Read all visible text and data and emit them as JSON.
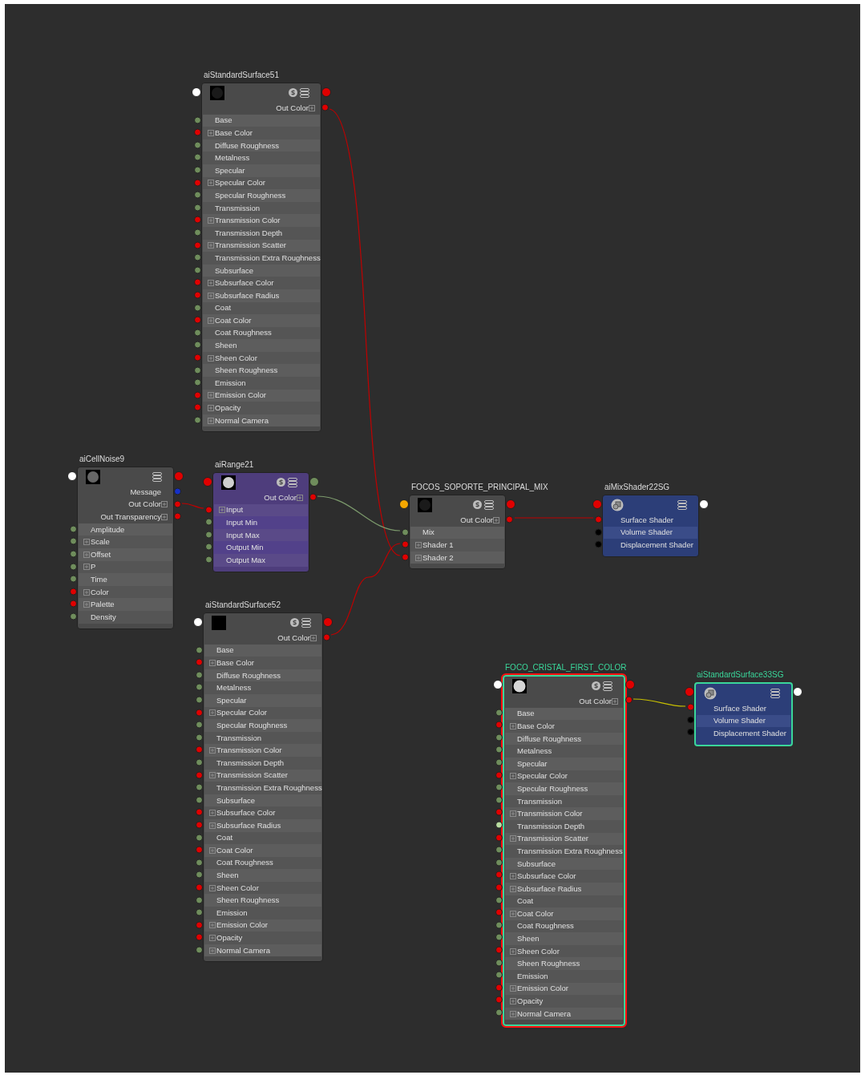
{
  "nodes": [
    {
      "title": "aiStandardSurface51",
      "kind": "shader",
      "selected": false,
      "focused": false,
      "swatch": {
        "kind": "dark_sphere"
      },
      "s_icon": true,
      "in_port": {
        "color": "#ffffff"
      },
      "out_port": {
        "color": "#e00000"
      },
      "outputs": [
        {
          "label": "Out Color",
          "color": "#e00000",
          "expandable": true
        }
      ],
      "attributes": [
        {
          "label": "Base",
          "color": "#6f8d5c",
          "expandable": false
        },
        {
          "label": "Base Color",
          "color": "#e00000",
          "expandable": true
        },
        {
          "label": "Diffuse Roughness",
          "color": "#6f8d5c",
          "expandable": false
        },
        {
          "label": "Metalness",
          "color": "#6f8d5c",
          "expandable": false
        },
        {
          "label": "Specular",
          "color": "#6f8d5c",
          "expandable": false
        },
        {
          "label": "Specular Color",
          "color": "#e00000",
          "expandable": true
        },
        {
          "label": "Specular Roughness",
          "color": "#6f8d5c",
          "expandable": false
        },
        {
          "label": "Transmission",
          "color": "#6f8d5c",
          "expandable": false
        },
        {
          "label": "Transmission Color",
          "color": "#e00000",
          "expandable": true
        },
        {
          "label": "Transmission Depth",
          "color": "#6f8d5c",
          "expandable": false
        },
        {
          "label": "Transmission Scatter",
          "color": "#e00000",
          "expandable": true
        },
        {
          "label": "Transmission Extra Roughness",
          "color": "#6f8d5c",
          "expandable": false
        },
        {
          "label": "Subsurface",
          "color": "#6f8d5c",
          "expandable": false
        },
        {
          "label": "Subsurface Color",
          "color": "#e00000",
          "expandable": true
        },
        {
          "label": "Subsurface Radius",
          "color": "#e00000",
          "expandable": true
        },
        {
          "label": "Coat",
          "color": "#6f8d5c",
          "expandable": false
        },
        {
          "label": "Coat Color",
          "color": "#e00000",
          "expandable": true
        },
        {
          "label": "Coat Roughness",
          "color": "#6f8d5c",
          "expandable": false
        },
        {
          "label": "Sheen",
          "color": "#6f8d5c",
          "expandable": false
        },
        {
          "label": "Sheen Color",
          "color": "#e00000",
          "expandable": true
        },
        {
          "label": "Sheen Roughness",
          "color": "#6f8d5c",
          "expandable": false
        },
        {
          "label": "Emission",
          "color": "#6f8d5c",
          "expandable": false
        },
        {
          "label": "Emission Color",
          "color": "#e00000",
          "expandable": true
        },
        {
          "label": "Opacity",
          "color": "#e00000",
          "expandable": true
        },
        {
          "label": "Normal Camera",
          "color": "#6f8d5c",
          "expandable": true
        }
      ]
    },
    {
      "title": "aiCellNoise9",
      "kind": "texture",
      "selected": false,
      "focused": false,
      "swatch": {
        "kind": "gray_noise"
      },
      "s_icon": false,
      "in_port": {
        "color": "#ffffff"
      },
      "out_port": {
        "color": "#e00000"
      },
      "outputs": [
        {
          "label": "Message",
          "color": "#1530c8",
          "expandable": false
        },
        {
          "label": "Out Color",
          "color": "#e00000",
          "expandable": true
        },
        {
          "label": "Out Transparency",
          "color": "#e00000",
          "expandable": true
        }
      ],
      "attributes": [
        {
          "label": "Amplitude",
          "color": "#6f8d5c",
          "expandable": false
        },
        {
          "label": "Scale",
          "color": "#6f8d5c",
          "expandable": true
        },
        {
          "label": "Offset",
          "color": "#6f8d5c",
          "expandable": true
        },
        {
          "label": "P",
          "color": "#6f8d5c",
          "expandable": true
        },
        {
          "label": "Time",
          "color": "#6f8d5c",
          "expandable": false
        },
        {
          "label": "Color",
          "color": "#e00000",
          "expandable": true
        },
        {
          "label": "Palette",
          "color": "#e00000",
          "expandable": true
        },
        {
          "label": "Density",
          "color": "#6f8d5c",
          "expandable": false
        }
      ]
    },
    {
      "title": "aiRange21",
      "kind": "utility",
      "selected": false,
      "focused": false,
      "swatch": {
        "kind": "white_noise"
      },
      "s_icon": true,
      "in_port": {
        "color": "#e00000"
      },
      "out_port": {
        "color": "#6f8d5c"
      },
      "outputs": [
        {
          "label": "Out Color",
          "color": "#e00000",
          "expandable": true
        }
      ],
      "attributes": [
        {
          "label": "Input",
          "color": "#e00000",
          "expandable": true
        },
        {
          "label": "Input Min",
          "color": "#6f8d5c",
          "expandable": false
        },
        {
          "label": "Input Max",
          "color": "#6f8d5c",
          "expandable": false
        },
        {
          "label": "Output Min",
          "color": "#6f8d5c",
          "expandable": false
        },
        {
          "label": "Output Max",
          "color": "#6f8d5c",
          "expandable": false
        }
      ]
    },
    {
      "title": "aiStandardSurface52",
      "kind": "shader",
      "selected": false,
      "focused": false,
      "swatch": {
        "kind": "black"
      },
      "s_icon": true,
      "in_port": {
        "color": "#ffffff"
      },
      "out_port": {
        "color": "#e00000"
      },
      "outputs": [
        {
          "label": "Out Color",
          "color": "#e00000",
          "expandable": true
        }
      ],
      "attributes": [
        {
          "label": "Base",
          "color": "#6f8d5c",
          "expandable": false
        },
        {
          "label": "Base Color",
          "color": "#e00000",
          "expandable": true
        },
        {
          "label": "Diffuse Roughness",
          "color": "#6f8d5c",
          "expandable": false
        },
        {
          "label": "Metalness",
          "color": "#6f8d5c",
          "expandable": false
        },
        {
          "label": "Specular",
          "color": "#6f8d5c",
          "expandable": false
        },
        {
          "label": "Specular Color",
          "color": "#e00000",
          "expandable": true
        },
        {
          "label": "Specular Roughness",
          "color": "#6f8d5c",
          "expandable": false
        },
        {
          "label": "Transmission",
          "color": "#6f8d5c",
          "expandable": false
        },
        {
          "label": "Transmission Color",
          "color": "#e00000",
          "expandable": true
        },
        {
          "label": "Transmission Depth",
          "color": "#6f8d5c",
          "expandable": false
        },
        {
          "label": "Transmission Scatter",
          "color": "#e00000",
          "expandable": true
        },
        {
          "label": "Transmission Extra Roughness",
          "color": "#6f8d5c",
          "expandable": false
        },
        {
          "label": "Subsurface",
          "color": "#6f8d5c",
          "expandable": false
        },
        {
          "label": "Subsurface Color",
          "color": "#e00000",
          "expandable": true
        },
        {
          "label": "Subsurface Radius",
          "color": "#e00000",
          "expandable": true
        },
        {
          "label": "Coat",
          "color": "#6f8d5c",
          "expandable": false
        },
        {
          "label": "Coat Color",
          "color": "#e00000",
          "expandable": true
        },
        {
          "label": "Coat Roughness",
          "color": "#6f8d5c",
          "expandable": false
        },
        {
          "label": "Sheen",
          "color": "#6f8d5c",
          "expandable": false
        },
        {
          "label": "Sheen Color",
          "color": "#e00000",
          "expandable": true
        },
        {
          "label": "Sheen Roughness",
          "color": "#6f8d5c",
          "expandable": false
        },
        {
          "label": "Emission",
          "color": "#6f8d5c",
          "expandable": false
        },
        {
          "label": "Emission Color",
          "color": "#e00000",
          "expandable": true
        },
        {
          "label": "Opacity",
          "color": "#e00000",
          "expandable": true
        },
        {
          "label": "Normal Camera",
          "color": "#6f8d5c",
          "expandable": true
        }
      ]
    },
    {
      "title": "FOCOS_SOPORTE_PRINCIPAL_MIX",
      "kind": "shader",
      "selected": false,
      "focused": false,
      "swatch": {
        "kind": "dark_sphere"
      },
      "s_icon": true,
      "in_port": {
        "color": "#f5a700"
      },
      "out_port": {
        "color": "#e00000"
      },
      "outputs": [
        {
          "label": "Out Color",
          "color": "#e00000",
          "expandable": true
        }
      ],
      "attributes": [
        {
          "label": "Mix",
          "color": "#6f8d5c",
          "expandable": false
        },
        {
          "label": "Shader 1",
          "color": "#e00000",
          "expandable": true
        },
        {
          "label": "Shader 2",
          "color": "#e00000",
          "expandable": true
        }
      ]
    },
    {
      "title": "aiMixShader22SG",
      "kind": "shading_group",
      "selected": false,
      "focused": false,
      "swatch": {
        "kind": "shading_group"
      },
      "s_icon": false,
      "in_port": {
        "color": "#e00000"
      },
      "out_port": {
        "color": "#ffffff"
      },
      "attributes": [
        {
          "label": "Surface Shader",
          "color": "#e00000",
          "expandable": false
        },
        {
          "label": "Volume Shader",
          "color": "#000000",
          "expandable": false
        },
        {
          "label": "Displacement Shader",
          "color": "#000000",
          "expandable": false
        }
      ]
    },
    {
      "title": "FOCO_CRISTAL_FIRST_COLOR",
      "kind": "shader",
      "selected": true,
      "focused": true,
      "swatch": {
        "kind": "white_sphere"
      },
      "s_icon": true,
      "in_port": {
        "color": "#ffffff"
      },
      "out_port": {
        "color": "#e00000"
      },
      "outputs": [
        {
          "label": "Out Color",
          "color": "#e00000",
          "expandable": true
        }
      ],
      "attributes": [
        {
          "label": "Base",
          "color": "#6f8d5c",
          "expandable": false
        },
        {
          "label": "Base Color",
          "color": "#e00000",
          "expandable": true
        },
        {
          "label": "Diffuse Roughness",
          "color": "#6f8d5c",
          "expandable": false
        },
        {
          "label": "Metalness",
          "color": "#6f8d5c",
          "expandable": false
        },
        {
          "label": "Specular",
          "color": "#6f8d5c",
          "expandable": false
        },
        {
          "label": "Specular Color",
          "color": "#e00000",
          "expandable": true
        },
        {
          "label": "Specular Roughness",
          "color": "#6f8d5c",
          "expandable": false
        },
        {
          "label": "Transmission",
          "color": "#6f8d5c",
          "expandable": false
        },
        {
          "label": "Transmission Color",
          "color": "#e00000",
          "expandable": true
        },
        {
          "label": "Transmission Depth",
          "color": "#b8dca0",
          "expandable": false
        },
        {
          "label": "Transmission Scatter",
          "color": "#e00000",
          "expandable": true
        },
        {
          "label": "Transmission Extra Roughness",
          "color": "#6f8d5c",
          "expandable": false
        },
        {
          "label": "Subsurface",
          "color": "#6f8d5c",
          "expandable": false
        },
        {
          "label": "Subsurface Color",
          "color": "#e00000",
          "expandable": true
        },
        {
          "label": "Subsurface Radius",
          "color": "#e00000",
          "expandable": true
        },
        {
          "label": "Coat",
          "color": "#6f8d5c",
          "expandable": false
        },
        {
          "label": "Coat Color",
          "color": "#e00000",
          "expandable": true
        },
        {
          "label": "Coat Roughness",
          "color": "#6f8d5c",
          "expandable": false
        },
        {
          "label": "Sheen",
          "color": "#6f8d5c",
          "expandable": false
        },
        {
          "label": "Sheen Color",
          "color": "#e00000",
          "expandable": true
        },
        {
          "label": "Sheen Roughness",
          "color": "#6f8d5c",
          "expandable": false
        },
        {
          "label": "Emission",
          "color": "#6f8d5c",
          "expandable": false
        },
        {
          "label": "Emission Color",
          "color": "#e00000",
          "expandable": true
        },
        {
          "label": "Opacity",
          "color": "#e00000",
          "expandable": true
        },
        {
          "label": "Normal Camera",
          "color": "#6f8d5c",
          "expandable": true
        }
      ]
    },
    {
      "title": "aiStandardSurface33SG",
      "kind": "shading_group",
      "selected": true,
      "focused": false,
      "swatch": {
        "kind": "shading_group"
      },
      "s_icon": false,
      "in_port": {
        "color": "#e00000"
      },
      "out_port": {
        "color": "#ffffff"
      },
      "attributes": [
        {
          "label": "Surface Shader",
          "color": "#e00000",
          "expandable": false
        },
        {
          "label": "Volume Shader",
          "color": "#000000",
          "expandable": false
        },
        {
          "label": "Displacement Shader",
          "color": "#000000",
          "expandable": false
        }
      ]
    }
  ]
}
